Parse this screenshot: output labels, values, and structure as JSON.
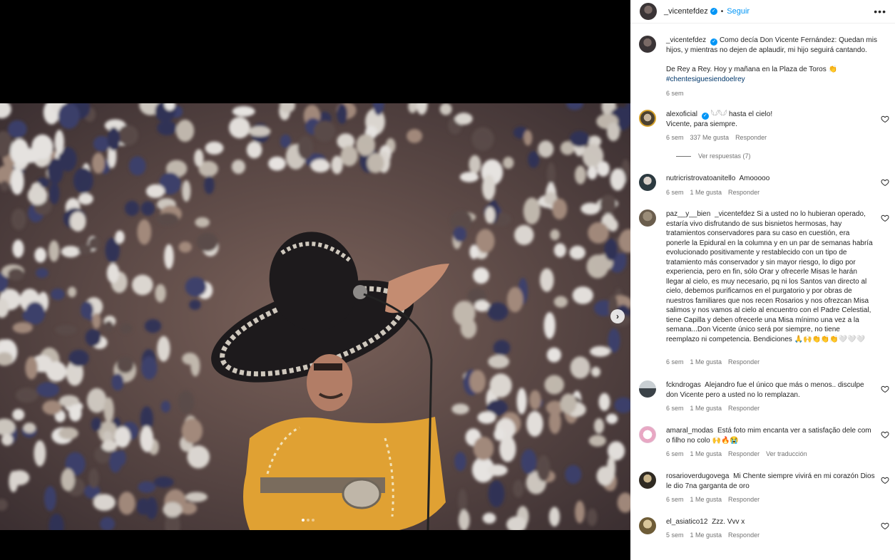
{
  "post": {
    "author": "_vicentefdez",
    "follow_label": "Seguir",
    "dot_separator": "•",
    "more_icon": "more-horizontal-icon",
    "caption_line1": "Como decía Don Vicente Fernández: Quedan mis hijos, y mientras no dejen de aplaudir, mi hijo seguirá cantando.",
    "caption_line2": "De Rey a Rey. Hoy y mañana en la Plaza de Toros 👏",
    "hashtag": "#chentesiguesiendoelrey",
    "caption_time": "6 sem",
    "carousel_count": 3,
    "carousel_active": 0
  },
  "comments": [
    {
      "user": "alexoficial",
      "verified": true,
      "text": "𓆩𓆪𓆩𓆪 hasta el cielo!\nVicente, para siempre.",
      "time": "6 sem",
      "likes": "337 Me gusta",
      "reply": "Responder",
      "view_replies": "Ver respuestas (7)"
    },
    {
      "user": "nutricristrovatoanitello",
      "text": "Amooooo",
      "time": "6 sem",
      "likes": "1 Me gusta",
      "reply": "Responder"
    },
    {
      "user": "paz__y__bien",
      "text": "_vicentefdez Si a usted no lo hubieran operado, estaría vivo disfrutando de sus bisnietos hermosas, hay tratamientos conservadores para su caso en cuestión, era ponerle la Epidural en la columna y en un par de semanas habría evolucionado positivamente y restablecido con un tipo de tratamiento más conservador y sin mayor riesgo, lo digo por experiencia, pero en fin, sólo Orar y ofrecerle Misas le harán llegar al cielo, es muy necesario, pq ni los Santos van directo al cielo, debemos purificarnos en el purgatorio y por obras de nuestros familiares que nos recen Rosarios y nos ofrezcan Misa salimos y nos vamos al cielo al encuentro con el Padre Celestial, tiene Capilla y deben ofrecerle una Misa mínimo una vez a la semana...Don Vicente único será por siempre, no tiene reemplazo ni competencia. Bendiciones 🙏🙌👏👏👏🤍🤍🤍",
      "time": "6 sem",
      "likes": "1 Me gusta",
      "reply": "Responder"
    },
    {
      "user": "fckndrogas",
      "text": "Alejandro fue el único que más o menos.. disculpe don Vicente pero a usted no lo remplazan.",
      "time": "6 sem",
      "likes": "1 Me gusta",
      "reply": "Responder"
    },
    {
      "user": "amaral_modas",
      "text": "Está foto mim encanta ver a satisfação dele com o filho no colo 🙌🔥😭",
      "time": "6 sem",
      "likes": "1 Me gusta",
      "reply": "Responder",
      "translate": "Ver traducción"
    },
    {
      "user": "rosarioverdugovega",
      "text": "Mi Chente siempre vivirá en mi corazón Dios le dio 7na garganta de oro",
      "time": "6 sem",
      "likes": "1 Me gusta",
      "reply": "Responder"
    },
    {
      "user": "el_asiatico12",
      "text": "Zzz. Vvv x",
      "time": "5 sem",
      "likes": "1 Me gusta",
      "reply": "Responder"
    }
  ],
  "icons": {
    "heart": "heart-outline-icon",
    "next": "chevron-right-icon",
    "verified": "verified-badge-icon"
  },
  "colors": {
    "accent": "#0095f6",
    "muted": "#737373",
    "text": "#262626"
  }
}
